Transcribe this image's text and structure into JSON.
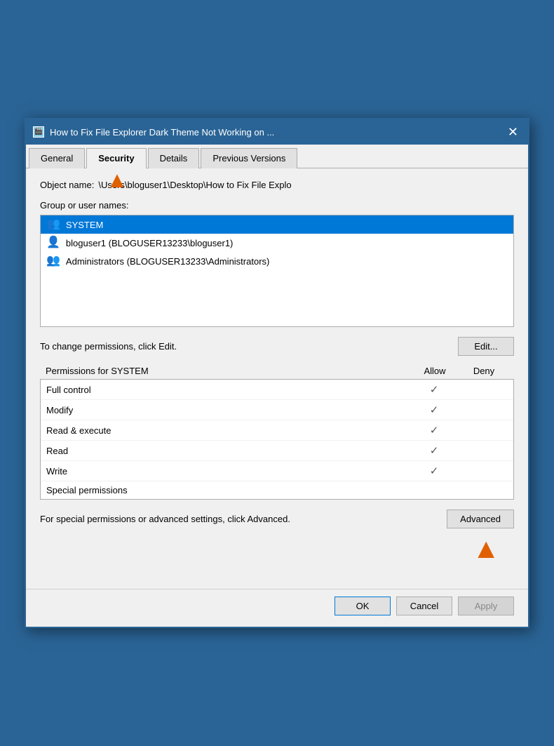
{
  "titleBar": {
    "icon": "🎬",
    "title": "How to Fix File Explorer Dark Theme Not Working on ...",
    "closeLabel": "✕"
  },
  "tabs": [
    {
      "id": "general",
      "label": "General",
      "active": false
    },
    {
      "id": "security",
      "label": "Security",
      "active": true
    },
    {
      "id": "details",
      "label": "Details",
      "active": false
    },
    {
      "id": "previous-versions",
      "label": "Previous Versions",
      "active": false
    }
  ],
  "objectName": {
    "label": "Object name:",
    "value": "\\Users\\bloguser1\\Desktop\\How to Fix File Explo"
  },
  "groupsLabel": "Group or user names:",
  "users": [
    {
      "id": "system",
      "icon": "👥",
      "label": "SYSTEM",
      "selected": true
    },
    {
      "id": "bloguser1",
      "icon": "👤",
      "label": "bloguser1 (BLOGUSER13233\\bloguser1)",
      "selected": false
    },
    {
      "id": "administrators",
      "icon": "👥",
      "label": "Administrators (BLOGUSER13233\\Administrators)",
      "selected": false
    }
  ],
  "editRow": {
    "text": "To change permissions, click Edit.",
    "buttonLabel": "Edit..."
  },
  "permissionsHeader": {
    "nameLabel": "Permissions for SYSTEM",
    "allowLabel": "Allow",
    "denyLabel": "Deny"
  },
  "permissions": [
    {
      "name": "Full control",
      "allow": true,
      "deny": false
    },
    {
      "name": "Modify",
      "allow": true,
      "deny": false
    },
    {
      "name": "Read & execute",
      "allow": true,
      "deny": false
    },
    {
      "name": "Read",
      "allow": true,
      "deny": false
    },
    {
      "name": "Write",
      "allow": true,
      "deny": false
    },
    {
      "name": "Special permissions",
      "allow": false,
      "deny": false
    }
  ],
  "advancedRow": {
    "text": "For special permissions or advanced settings, click Advanced.",
    "buttonLabel": "Advanced"
  },
  "footer": {
    "okLabel": "OK",
    "cancelLabel": "Cancel",
    "applyLabel": "Apply"
  }
}
